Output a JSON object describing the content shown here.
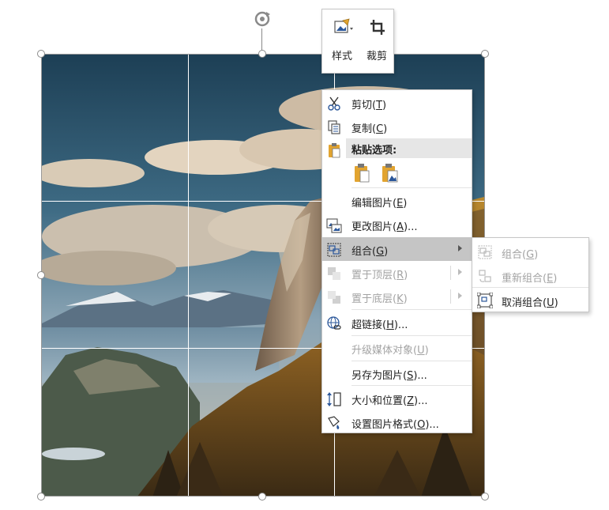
{
  "mini_toolbar": {
    "style_label": "样式",
    "crop_label": "裁剪"
  },
  "context_menu": {
    "cut": {
      "text": "剪切(",
      "key": "T",
      "end": ")"
    },
    "copy": {
      "text": "复制(",
      "key": "C",
      "end": ")"
    },
    "paste_options": "粘贴选项:",
    "edit_picture": {
      "text": "编辑图片(",
      "key": "E",
      "end": ")"
    },
    "change_picture": {
      "text": "更改图片(",
      "key": "A",
      "end": ")..."
    },
    "group": {
      "text": "组合(",
      "key": "G",
      "end": ")"
    },
    "bring_to_front": {
      "text": "置于顶层(",
      "key": "R",
      "end": ")"
    },
    "send_to_back": {
      "text": "置于底层(",
      "key": "K",
      "end": ")"
    },
    "hyperlink": {
      "text": "超链接(",
      "key": "H",
      "end": ")..."
    },
    "upgrade_media": {
      "text": "升级媒体对象(",
      "key": "U",
      "end": ")"
    },
    "save_as_picture": {
      "text": "另存为图片(",
      "key": "S",
      "end": ")..."
    },
    "size_position": {
      "text": "大小和位置(",
      "key": "Z",
      "end": ")..."
    },
    "format_picture": {
      "text": "设置图片格式(",
      "key": "O",
      "end": ")..."
    }
  },
  "submenu": {
    "group": {
      "text": "组合(",
      "key": "G",
      "end": ")"
    },
    "regroup": {
      "text": "重新组合(",
      "key": "E",
      "end": ")"
    },
    "ungroup": {
      "text": "取消组合(",
      "key": "U",
      "end": ")"
    }
  },
  "colors": {
    "hover": "#c5c5c5",
    "disabled_text": "#a3a3a3",
    "icon_blue": "#2b579a",
    "icon_gold": "#e2a430"
  }
}
